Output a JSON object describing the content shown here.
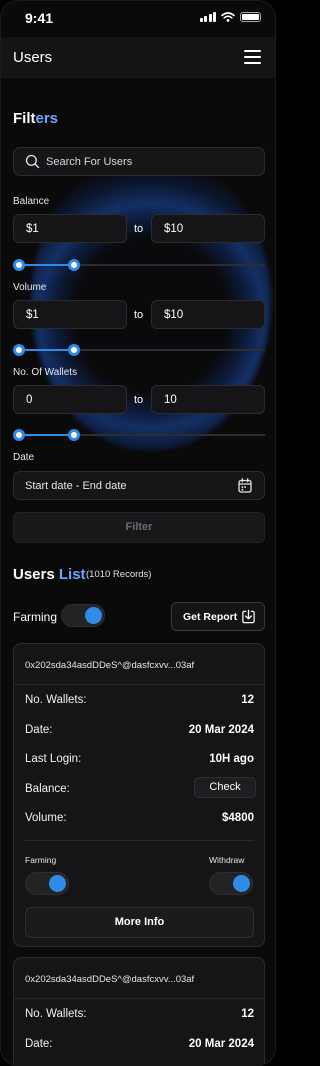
{
  "status_bar": {
    "time": "9:41"
  },
  "header": {
    "title": "Users"
  },
  "filters": {
    "title_main": "Filt",
    "title_accent": "ers",
    "search_placeholder": "Search For Users",
    "balance": {
      "label": "Balance",
      "from": "$1",
      "to_word": "to",
      "to": "$10",
      "range_low": 0,
      "range_high": 0.22
    },
    "volume": {
      "label": "Volume",
      "from": "$1",
      "to_word": "to",
      "to": "$10",
      "range_low": 0,
      "range_high": 0.22
    },
    "wallets": {
      "label": "No. Of Wallets",
      "from": "0",
      "to_word": "to",
      "to": "10",
      "range_low": 0,
      "range_high": 0.22
    },
    "date": {
      "label": "Date",
      "placeholder": "Start date - End date"
    },
    "filter_button": "Filter"
  },
  "users_list": {
    "title_main": "Users ",
    "title_accent": "List",
    "records": "(1010 Records)",
    "farming_label": "Farming",
    "farming_on": true,
    "report_button": "Get Report"
  },
  "cards": [
    {
      "address": "0x202sda34asdDDeS^@dasfcxvv...03af",
      "wallets_label": "No. Wallets:",
      "wallets": "12",
      "date_label": "Date:",
      "date": "20 Mar 2024",
      "login_label": "Last Login:",
      "login": "10H ago",
      "balance_label": "Balance:",
      "balance_button": "Check",
      "volume_label": "Volume:",
      "volume": "$4800",
      "farming_label": "Farming",
      "withdraw_label": "Withdraw",
      "more_button": "More Info"
    },
    {
      "address": "0x202sda34asdDDeS^@dasfcxvv...03af",
      "wallets_label": "No. Wallets:",
      "wallets": "12",
      "date_label": "Date:",
      "date": "20 Mar 2024"
    }
  ],
  "colors": {
    "accent": "#2f8be8",
    "title_accent": "#6aa6ff",
    "background": "#0a0a0b"
  }
}
